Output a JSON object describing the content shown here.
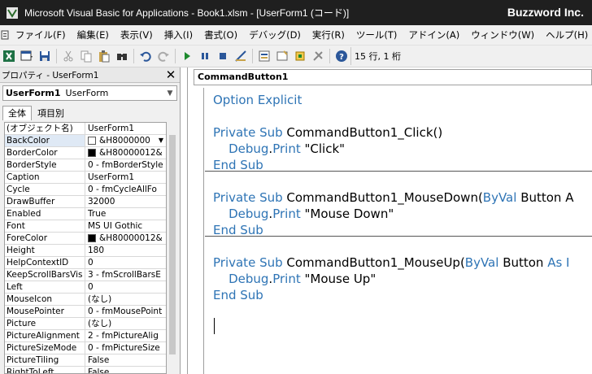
{
  "window": {
    "title": "Microsoft Visual Basic for Applications - Book1.xlsm - [UserForm1 (コード)]",
    "brand": "Buzzword Inc."
  },
  "menu": [
    "ファイル(F)",
    "編集(E)",
    "表示(V)",
    "挿入(I)",
    "書式(O)",
    "デバッグ(D)",
    "実行(R)",
    "ツール(T)",
    "アドイン(A)",
    "ウィンドウ(W)",
    "ヘルプ(H)"
  ],
  "toolbar": {
    "position_text": "15 行, 1 桁",
    "icons": [
      "excel-icon",
      "insert-icon",
      "save-icon",
      "cut-icon",
      "copy-icon",
      "paste-icon",
      "find-icon",
      "undo-icon",
      "redo-icon",
      "run-icon",
      "break-icon",
      "reset-icon",
      "design-mode-icon",
      "project-explorer-icon",
      "properties-icon",
      "object-browser-icon",
      "toolbox-icon",
      "help-icon"
    ]
  },
  "properties": {
    "title": "プロパティ - UserForm1",
    "object_name": "UserForm1",
    "object_type": "UserForm",
    "tabs": [
      "全体",
      "項目別"
    ],
    "rows": [
      {
        "name": "(オブジェクト名)",
        "value": "UserForm1"
      },
      {
        "name": "BackColor",
        "value": "&H8000000",
        "swatch": "#ffffff",
        "dropdown": true
      },
      {
        "name": "BorderColor",
        "value": "&H80000012&",
        "swatch": "#000000"
      },
      {
        "name": "BorderStyle",
        "value": "0 - fmBorderStyle"
      },
      {
        "name": "Caption",
        "value": "UserForm1"
      },
      {
        "name": "Cycle",
        "value": "0 - fmCycleAllFo"
      },
      {
        "name": "DrawBuffer",
        "value": "32000"
      },
      {
        "name": "Enabled",
        "value": "True"
      },
      {
        "name": "Font",
        "value": "MS UI Gothic"
      },
      {
        "name": "ForeColor",
        "value": "&H80000012&",
        "swatch": "#000000"
      },
      {
        "name": "Height",
        "value": "180"
      },
      {
        "name": "HelpContextID",
        "value": "0"
      },
      {
        "name": "KeepScrollBarsVis",
        "value": "3 - fmScrollBarsE"
      },
      {
        "name": "Left",
        "value": "0"
      },
      {
        "name": "MouseIcon",
        "value": "(なし)"
      },
      {
        "name": "MousePointer",
        "value": "0 - fmMousePoint"
      },
      {
        "name": "Picture",
        "value": "(なし)"
      },
      {
        "name": "PictureAlignment",
        "value": "2 - fmPictureAlig"
      },
      {
        "name": "PictureSizeMode",
        "value": "0 - fmPictureSize"
      },
      {
        "name": "PictureTiling",
        "value": "False"
      },
      {
        "name": "RightToLeft",
        "value": "False"
      }
    ]
  },
  "code": {
    "procedure": "CommandButton1",
    "lines": [
      [
        {
          "t": "Option Explicit",
          "k": true
        }
      ],
      [],
      [
        {
          "t": "Private Sub ",
          "k": true
        },
        {
          "t": "CommandButton1_Click()"
        }
      ],
      [
        {
          "t": "    "
        },
        {
          "t": "Debug",
          "k": true
        },
        {
          "t": "."
        },
        {
          "t": "Print",
          "k": true
        },
        {
          "t": " \"Click\""
        }
      ],
      [
        {
          "t": "End Sub",
          "k": true
        }
      ],
      [],
      [
        {
          "t": "Private Sub ",
          "k": true
        },
        {
          "t": "CommandButton1_MouseDown("
        },
        {
          "t": "ByVal",
          "k": true
        },
        {
          "t": " Button A"
        }
      ],
      [
        {
          "t": "    "
        },
        {
          "t": "Debug",
          "k": true
        },
        {
          "t": "."
        },
        {
          "t": "Print",
          "k": true
        },
        {
          "t": " \"Mouse Down\""
        }
      ],
      [
        {
          "t": "End Sub",
          "k": true
        }
      ],
      [],
      [
        {
          "t": "Private Sub ",
          "k": true
        },
        {
          "t": "CommandButton1_MouseUp("
        },
        {
          "t": "ByVal",
          "k": true
        },
        {
          "t": " Button "
        },
        {
          "t": "As I",
          "k": true
        }
      ],
      [
        {
          "t": "    "
        },
        {
          "t": "Debug",
          "k": true
        },
        {
          "t": "."
        },
        {
          "t": "Print",
          "k": true
        },
        {
          "t": " \"Mouse Up\""
        }
      ],
      [
        {
          "t": "End Sub",
          "k": true
        }
      ]
    ]
  },
  "colors": {
    "keyword": "#2e74b5",
    "titlebar": "#1f1f1f"
  }
}
